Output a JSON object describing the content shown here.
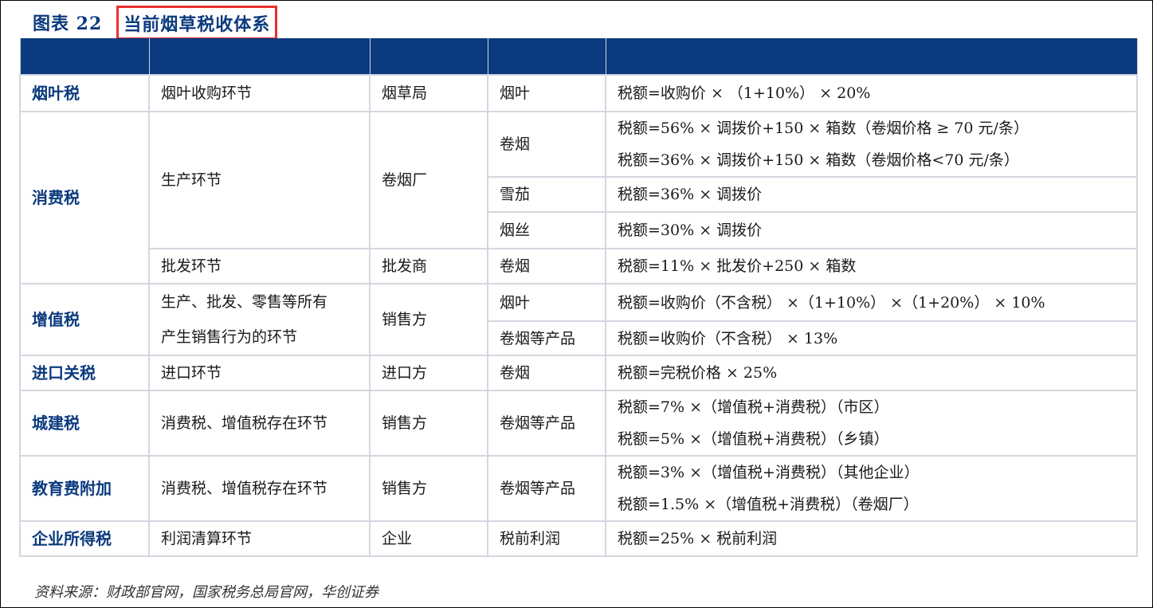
{
  "figure": {
    "number": "图表 22",
    "title": "当前烟草税收体系"
  },
  "rows": {
    "r1": {
      "tax": "烟叶税",
      "stage": "烟叶收购环节",
      "payer": "烟草局",
      "product": "烟叶",
      "formula": "税额=收购价 × （1+10%） × 20%"
    },
    "consumption": {
      "tax": "消费税",
      "prod_stage": "生产环节",
      "prod_payer": "卷烟厂",
      "cig": "卷烟",
      "cig_f1": "税额=56% × 调拨价+150 × 箱数（卷烟价格 ≥ 70 元/条）",
      "cig_f2": "税额=36% × 调拨价+150 × 箱数（卷烟价格<70 元/条）",
      "cigar": "雪茄",
      "cigar_f": "税额=36% × 调拨价",
      "shred": "烟丝",
      "shred_f": "税额=30% × 调拨价",
      "whole_stage": "批发环节",
      "whole_payer": "批发商",
      "whole_product": "卷烟",
      "whole_f": "税额=11% × 批发价+250 × 箱数"
    },
    "vat": {
      "tax": "增值税",
      "stage_l1": "生产、批发、零售等所有",
      "stage_l2": "产生销售行为的环节",
      "payer": "销售方",
      "p1": "烟叶",
      "f1": "税额=收购价（不含税） ×（1+10%） ×（1+20%） × 10%",
      "p2": "卷烟等产品",
      "f2": "税额=收购价（不含税） × 13%"
    },
    "import": {
      "tax": "进口关税",
      "stage": "进口环节",
      "payer": "进口方",
      "product": "卷烟",
      "formula": "税额=完税价格 × 25%"
    },
    "urban": {
      "tax": "城建税",
      "stage": "消费税、增值税存在环节",
      "payer": "销售方",
      "product": "卷烟等产品",
      "f1": "税额=7% ×（增值税+消费税）（市区）",
      "f2": "税额=5% ×（增值税+消费税）（乡镇）"
    },
    "edu": {
      "tax": "教育费附加",
      "stage": "消费税、增值税存在环节",
      "payer": "销售方",
      "product": "卷烟等产品",
      "f1": "税额=3% ×（增值税+消费税）（其他企业）",
      "f2": "税额=1.5% ×（增值税+消费税）（卷烟厂）"
    },
    "corp": {
      "tax": "企业所得税",
      "stage": "利润清算环节",
      "payer": "企业",
      "product": "税前利润",
      "formula": "税额=25% × 税前利润"
    }
  },
  "source": "资料来源：财政部官网，国家税务总局官网，华创证券",
  "colors": {
    "header_bg": "#0b3a7e",
    "title_text": "#0b3a7e",
    "highlight_border": "#e8302f",
    "grid": "#d3d8e0"
  }
}
